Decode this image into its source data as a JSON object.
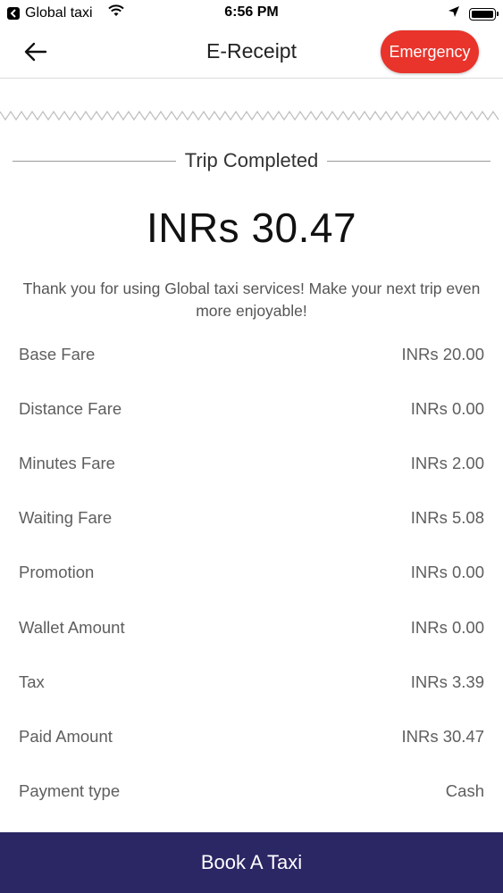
{
  "status_bar": {
    "back_app": "Global taxi",
    "time": "6:56 PM"
  },
  "header": {
    "title": "E-Receipt",
    "emergency_label": "Emergency"
  },
  "receipt": {
    "status": "Trip Completed",
    "total": "INRs 30.47",
    "thanks": "Thank you for using Global taxi services! Make your next trip even more enjoyable!"
  },
  "fares": [
    {
      "label": "Base Fare",
      "value": "INRs 20.00"
    },
    {
      "label": "Distance Fare",
      "value": "INRs 0.00"
    },
    {
      "label": "Minutes Fare",
      "value": "INRs 2.00"
    },
    {
      "label": "Waiting Fare",
      "value": "INRs 5.08"
    },
    {
      "label": "Promotion",
      "value": "INRs 0.00"
    },
    {
      "label": "Wallet Amount",
      "value": "INRs 0.00"
    },
    {
      "label": "Tax",
      "value": "INRs 3.39"
    },
    {
      "label": "Paid Amount",
      "value": "INRs 30.47"
    },
    {
      "label": "Payment type",
      "value": "Cash"
    }
  ],
  "footer": {
    "book_label": "Book A Taxi"
  },
  "colors": {
    "emergency": "#e8342b",
    "primary": "#2b2664"
  }
}
